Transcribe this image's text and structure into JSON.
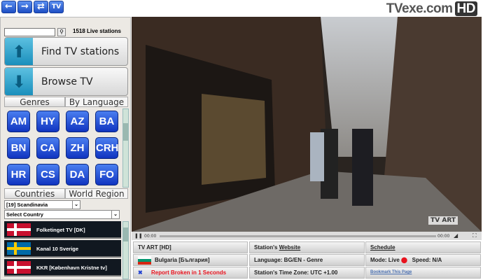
{
  "toolbar": {
    "back": "back-icon",
    "forward": "forward-icon",
    "refresh": "refresh-icon",
    "tv": "TV"
  },
  "logo": {
    "text": "TVexe.com",
    "badge": "HD"
  },
  "search": {
    "value": "",
    "count": "1518 Live stations"
  },
  "find_label": "Find TV stations",
  "browse_label": "Browse TV",
  "tabs1": [
    "Genres",
    "By Language"
  ],
  "languages": [
    "AM",
    "HY",
    "AZ",
    "BA",
    "BN",
    "CA",
    "ZH",
    "CRH",
    "HR",
    "CS",
    "DA",
    "FO"
  ],
  "tabs2": [
    "Countries",
    "World Region"
  ],
  "region_select": "[19] Scandinavia",
  "country_select": "Select Country",
  "stations": [
    {
      "name": "Folketinget TV [DK]",
      "flag": "denmark"
    },
    {
      "name": "Kanal 10 Sverige",
      "flag": "sweden"
    },
    {
      "name": "KKR [København Kristne tv]",
      "flag": "denmark"
    }
  ],
  "player": {
    "time_start": "00:00",
    "time_end": "00:00",
    "watermark": "TV ART"
  },
  "info": {
    "station": "TV ART [HD]",
    "website_prefix": "Station's ",
    "website_link": "Website",
    "schedule": "Schedule",
    "country": "Bulgaria [България]",
    "language": "Language: BG/EN  - Genre",
    "mode": "Mode: Live",
    "speed": "Speed: N/A",
    "report": "Report Broken in 1 Seconds",
    "timezone": "Station's Time Zone: UTC +1.00",
    "bookmark": "Bookmark This Page"
  },
  "colors": {
    "accent": "#1f4fc4",
    "report": "#e8121d",
    "bookmark": "#4a6fb0"
  }
}
